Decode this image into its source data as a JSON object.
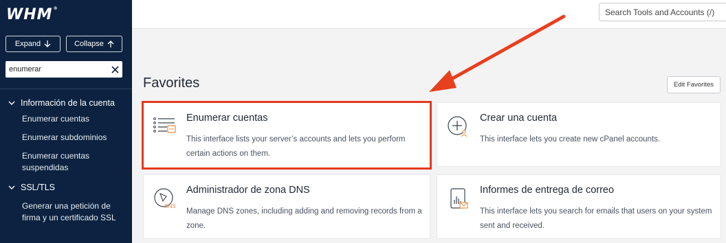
{
  "app": {
    "logo": "WHM",
    "logo_mark": "®"
  },
  "sidebar": {
    "expand_label": "Expand",
    "collapse_label": "Collapse",
    "search_value": "enumerar",
    "sections": [
      {
        "title": "Información de la cuenta",
        "items": [
          "Enumerar cuentas",
          "Enumerar subdominios",
          "Enumerar cuentas suspendidas"
        ]
      },
      {
        "title": "SSL/TLS",
        "items": [
          "Generar una petición de firma y un certificado SSL"
        ]
      }
    ]
  },
  "topbar": {
    "search_placeholder": "Search Tools and Accounts (/)"
  },
  "main": {
    "favorites_title": "Favorites",
    "edit_favorites_label": "Edit Favorites",
    "cards": [
      {
        "title": "Enumerar cuentas",
        "description": "This interface lists your server’s accounts and lets you perform certain actions on them.",
        "icon": "list-accounts-icon",
        "highlighted": true
      },
      {
        "title": "Crear una cuenta",
        "description": "This interface lets you create new cPanel accounts.",
        "icon": "create-account-icon",
        "highlighted": false
      },
      {
        "title": "Administrador de zona DNS",
        "description": "Manage DNS zones, including adding and removing records from a zone.",
        "icon": "dns-zone-icon",
        "icon_label": "DNS",
        "highlighted": false
      },
      {
        "title": "Informes de entrega de correo",
        "description": "This interface lets you search for emails that users on your system sent and received.",
        "icon": "mail-delivery-report-icon",
        "highlighted": false
      }
    ]
  },
  "colors": {
    "sidebar_bg": "#0c2240",
    "accent_orange": "#f08a3c",
    "highlight_red": "#e4391c",
    "page_bg": "#f3f3f4"
  }
}
